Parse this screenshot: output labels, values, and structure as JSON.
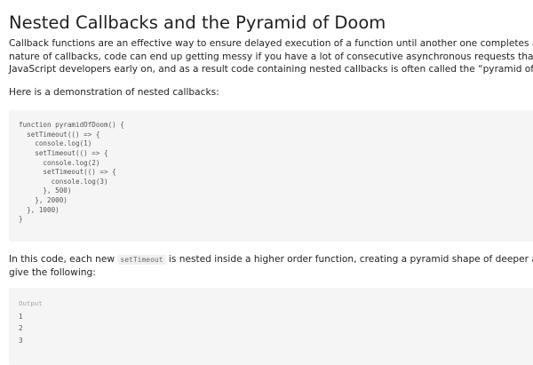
{
  "article": {
    "title": "Nested Callbacks and the Pyramid of Doom",
    "intro_lines": [
      "Callback functions are an effective way to ensure delayed execution of a function until another one completes and returns wit",
      "nature of callbacks, code can end up getting messy if you have a lot of consecutive asynchronous requests that rely on each o",
      "JavaScript developers early on, and as a result code containing nested callbacks is often called the “pyramid of doom” or “calll"
    ],
    "demo_intro": "Here is a demonstration of nested callbacks:",
    "code_lines": [
      "function pyramidOfDoom() {",
      "  setTimeout(() => {",
      "    console.log(1)",
      "    setTimeout(() => {",
      "      console.log(2)",
      "      setTimeout(() => {",
      "        console.log(3)",
      "      }, 500)",
      "    }, 2000)",
      "  }, 1000)",
      "}"
    ],
    "explanation": {
      "prefix": "In this code, each new ",
      "inline_code": "setTimeout",
      "suffix": " is nested inside a higher order function, creating a pyramid shape of deeper and deeper cal",
      "line2": "give the following:"
    },
    "output": {
      "label": "Output",
      "lines": [
        "1",
        "2",
        "3"
      ]
    }
  }
}
